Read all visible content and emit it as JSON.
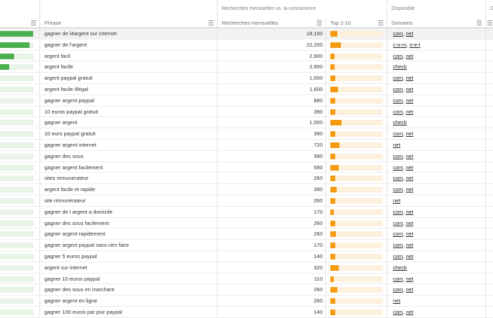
{
  "groups": {
    "competition": "Recherches mensuelles vs. la concurrence",
    "available": "Disponible",
    "extra": "G"
  },
  "columns": {
    "phrase": "Phrase",
    "volume": "Recherches mensuelles",
    "top": "Top 1-10",
    "domains": "Domains"
  },
  "colors": {
    "volume_bar": "#4caf50",
    "volume_track": "#e8f4e8",
    "top_bar": "#f59b12",
    "top_track": "#fdf0dd",
    "selected_row": "#f2f2f2"
  },
  "rows": [
    {
      "phrase": "gagner de l4argent sur internet",
      "volume": "18,100",
      "volume_level": 0.98,
      "top_level": 0.13,
      "domains": "com, net"
    },
    {
      "phrase": "gagner de l'argent",
      "volume": "22,200",
      "volume_level": 0.87,
      "top_level": 0.2,
      "domains": "c-o-m, n-e-t"
    },
    {
      "phrase": "argent facil",
      "volume": "2,900",
      "volume_level": 0.42,
      "top_level": 0.08,
      "domains": "com, net"
    },
    {
      "phrase": "argent facile",
      "volume": "2,900",
      "volume_level": 0.27,
      "top_level": 0.08,
      "domains": "check"
    },
    {
      "phrase": "argent paypal gratuit",
      "volume": "1,000",
      "volume_level": 0,
      "top_level": 0.09,
      "domains": "com, net"
    },
    {
      "phrase": "argent facile illégal",
      "volume": "1,600",
      "volume_level": 0,
      "top_level": 0.15,
      "domains": "com, net"
    },
    {
      "phrase": "gagner argent paypal",
      "volume": "880",
      "volume_level": 0,
      "top_level": 0.09,
      "domains": "com, net"
    },
    {
      "phrase": "10 euros paypal gratuit",
      "volume": "390",
      "volume_level": 0,
      "top_level": 0.09,
      "domains": "com, net"
    },
    {
      "phrase": "gagner argent",
      "volume": "1,000",
      "volume_level": 0,
      "top_level": 0.22,
      "domains": "check"
    },
    {
      "phrase": "10 euro paypal gratuit",
      "volume": "390",
      "volume_level": 0,
      "top_level": 0.09,
      "domains": "com, net"
    },
    {
      "phrase": "gagner argent internet",
      "volume": "720",
      "volume_level": 0,
      "top_level": 0.17,
      "domains": "net"
    },
    {
      "phrase": "gagner des sous",
      "volume": "390",
      "volume_level": 0,
      "top_level": 0.09,
      "domains": "com, net"
    },
    {
      "phrase": "gagner argent facilement",
      "volume": "590",
      "volume_level": 0,
      "top_level": 0.16,
      "domains": "com, net"
    },
    {
      "phrase": "sites remunerateur",
      "volume": "260",
      "volume_level": 0,
      "top_level": 0.09,
      "domains": "com, net"
    },
    {
      "phrase": "argent facile et rapide",
      "volume": "390",
      "volume_level": 0,
      "top_level": 0.12,
      "domains": "com, net"
    },
    {
      "phrase": "site rémunérateur",
      "volume": "260",
      "volume_level": 0,
      "top_level": 0.09,
      "domains": "net"
    },
    {
      "phrase": "gagner de l argent a domicile",
      "volume": "170",
      "volume_level": 0,
      "top_level": 0.07,
      "domains": "com, net"
    },
    {
      "phrase": "gagner des sous facilement",
      "volume": "260",
      "volume_level": 0,
      "top_level": 0.09,
      "domains": "com, net"
    },
    {
      "phrase": "gagner argent rapidement",
      "volume": "260",
      "volume_level": 0,
      "top_level": 0.11,
      "domains": "com, net"
    },
    {
      "phrase": "gagner argent paypal sans rien faire",
      "volume": "170",
      "volume_level": 0,
      "top_level": 0.09,
      "domains": "com, net"
    },
    {
      "phrase": "gagner 5 euros paypal",
      "volume": "140",
      "volume_level": 0,
      "top_level": 0.09,
      "domains": "com, net"
    },
    {
      "phrase": "argent sur internet",
      "volume": "320",
      "volume_level": 0,
      "top_level": 0.16,
      "domains": "check"
    },
    {
      "phrase": "gagner 10 euros paypal",
      "volume": "110",
      "volume_level": 0,
      "top_level": 0.07,
      "domains": "com, net"
    },
    {
      "phrase": "gagner des sous en marchant",
      "volume": "260",
      "volume_level": 0,
      "top_level": 0.13,
      "domains": "com, net"
    },
    {
      "phrase": "gagner argent en ligne",
      "volume": "260",
      "volume_level": 0,
      "top_level": 0.09,
      "domains": "net"
    },
    {
      "phrase": "gagner 100 euros par jour paypal",
      "volume": "140",
      "volume_level": 0,
      "top_level": 0.09,
      "domains": "com, net"
    }
  ]
}
